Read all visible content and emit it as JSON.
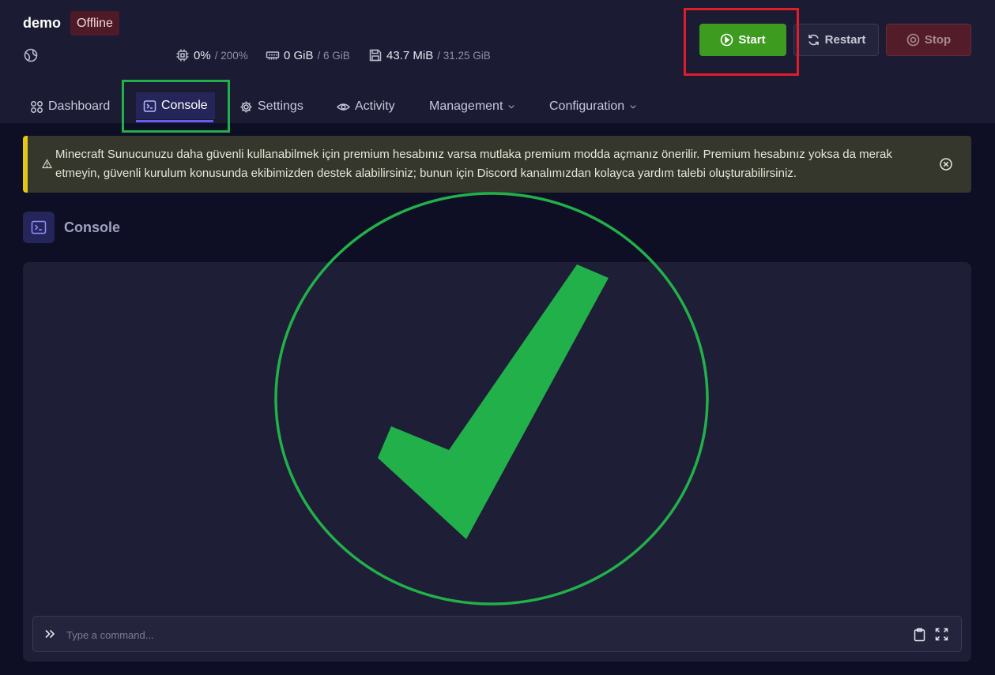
{
  "server": {
    "name": "demo",
    "status": "Offline"
  },
  "stats": {
    "cpu": {
      "value": "0%",
      "limit": "/ 200%"
    },
    "memory": {
      "value": "0 GiB",
      "limit": "/ 6 GiB"
    },
    "disk": {
      "value": "43.7 MiB",
      "limit": "/ 31.25 GiB"
    }
  },
  "actions": {
    "start": "Start",
    "restart": "Restart",
    "stop": "Stop"
  },
  "tabs": [
    {
      "label": "Dashboard"
    },
    {
      "label": "Console"
    },
    {
      "label": "Settings"
    },
    {
      "label": "Activity"
    },
    {
      "label": "Management"
    },
    {
      "label": "Configuration"
    }
  ],
  "alert": {
    "text": "Minecraft Sunucunuzu daha güvenli kullanabilmek için premium hesabınız varsa mutlaka premium modda açmanız önerilir. Premium hesabınız yoksa da merak etmeyin, güvenli kurulum konusunda ekibimizden destek alabilirsiniz; bunun için Discord kanalımızdan kolayca yardım talebi oluşturabilirsiniz."
  },
  "console": {
    "title": "Console",
    "placeholder": "Type a command..."
  },
  "colors": {
    "start": "#3d9b1f",
    "stop": "#521c28",
    "accent": "#6b5cf0",
    "highlight_red": "#e11d2a",
    "highlight_green": "#22b04a"
  }
}
